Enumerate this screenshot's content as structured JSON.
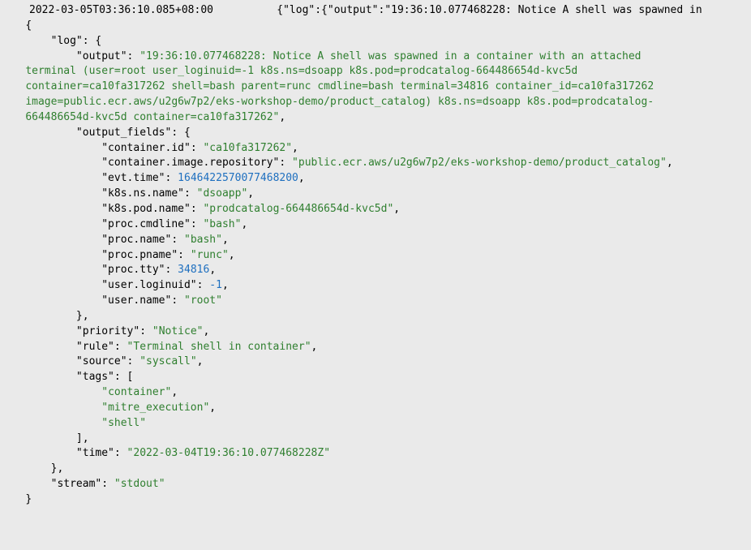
{
  "header": {
    "timestamp": "2022-03-05T03:36:10.085+08:00",
    "raw_preview": "{\"log\":{\"output\":\"19:36:10.077468228: Notice A shell was spawned in "
  },
  "log": {
    "output": "19:36:10.077468228: Notice A shell was spawned in a container with an attached terminal (user=root user_loginuid=-1 k8s.ns=dsoapp k8s.pod=prodcatalog-664486654d-kvc5d container=ca10fa317262 shell=bash parent=runc cmdline=bash terminal=34816 container_id=ca10fa317262 image=public.ecr.aws/u2g6w7p2/eks-workshop-demo/product_catalog) k8s.ns=dsoapp k8s.pod=prodcatalog-664486654d-kvc5d container=ca10fa317262",
    "output_fields": {
      "container.id": "ca10fa317262",
      "container.image.repository": "public.ecr.aws/u2g6w7p2/eks-workshop-demo/product_catalog",
      "evt.time": 1646422570077468228,
      "k8s.ns.name": "dsoapp",
      "k8s.pod.name": "prodcatalog-664486654d-kvc5d",
      "proc.cmdline": "bash",
      "proc.name": "bash",
      "proc.pname": "runc",
      "proc.tty": 34816,
      "user.loginuid": -1,
      "user.name": "root"
    },
    "priority": "Notice",
    "rule": "Terminal shell in container",
    "source": "syscall",
    "tags": [
      "container",
      "mitre_execution",
      "shell"
    ],
    "time": "2022-03-04T19:36:10.077468228Z"
  },
  "stream": "stdout",
  "output_wrapped": [
    "\"19:36:10.077468228: Notice A shell was spawned in a container with an attached ",
    "terminal (user=root user_loginuid=-1 k8s.ns=dsoapp k8s.pod=prodcatalog-664486654d-kvc5d ",
    "container=ca10fa317262 shell=bash parent=runc cmdline=bash terminal=34816 container_id=ca10fa317262 ",
    "image=public.ecr.aws/u2g6w7p2/eks-workshop-demo/product_catalog) k8s.ns=dsoapp k8s.pod=prodcatalog-",
    "664486654d-kvc5d container=ca10fa317262\""
  ]
}
